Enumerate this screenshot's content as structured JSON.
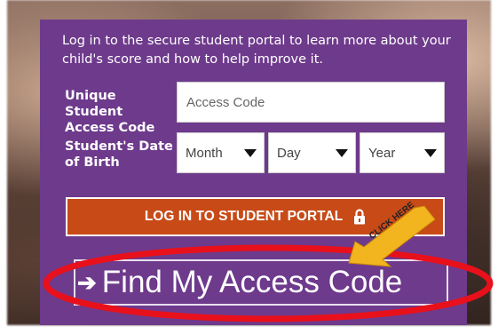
{
  "intro": "Log in to the secure student portal to learn more about your child's score and how to help improve it.",
  "form": {
    "code_label": "Unique Student Access Code",
    "code_placeholder": "Access Code",
    "dob_label": "Student's Date of Birth",
    "month": "Month",
    "day": "Day",
    "year": "Year"
  },
  "login_button": {
    "label": "LOG IN TO STUDENT PORTAL",
    "icon": "lock-icon"
  },
  "find_link": {
    "label": "Find My Access Code",
    "icon": "arrow-right-icon"
  },
  "annotation": {
    "callout": "CLICK HERE",
    "arrow_color": "#f2b41f",
    "ellipse_color": "#e8101a"
  },
  "colors": {
    "panel": "#6e3a8c",
    "button": "#c74a17"
  }
}
